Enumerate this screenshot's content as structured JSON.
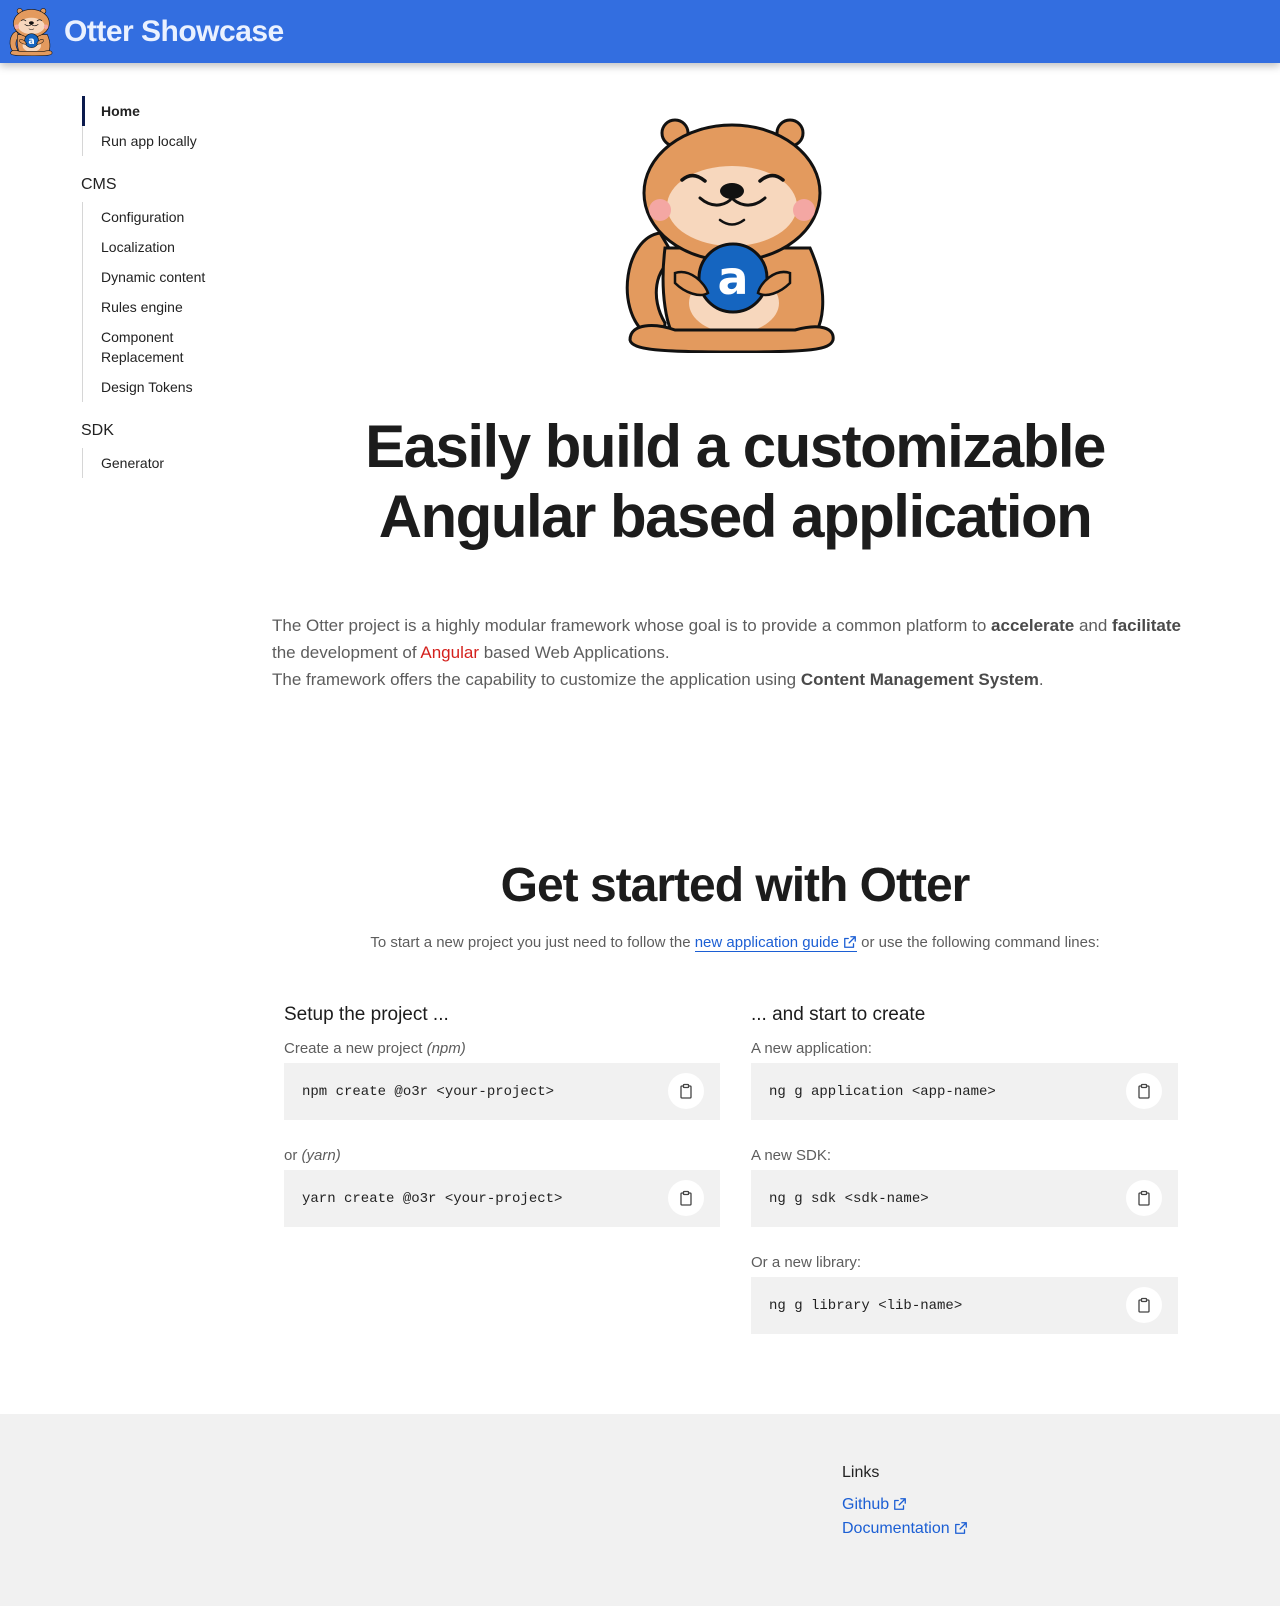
{
  "header": {
    "brand": "Otter Showcase",
    "logo_icon": "otter-logo-icon",
    "bar_color": "#336ee0"
  },
  "sidebar": {
    "top_items": [
      {
        "label": "Home",
        "active": true
      },
      {
        "label": "Run app locally"
      }
    ],
    "cms": {
      "heading": "CMS",
      "items": [
        "Configuration",
        "Localization",
        "Dynamic content",
        "Rules engine",
        "Component Replacement",
        "Design Tokens"
      ]
    },
    "sdk": {
      "heading": "SDK",
      "items": [
        "Generator"
      ]
    }
  },
  "hero": {
    "image_icon": "otter-mascot-icon",
    "mascot_letter": "a",
    "headline": "Easily build a customizable Angular based application"
  },
  "intro": {
    "p1_a": "The Otter project is a highly modular framework whose goal is to provide a common platform to ",
    "p1_b": "accelerate",
    "p1_c": " and ",
    "p1_d": "facilitate",
    "p1_e": " the development of ",
    "p1_f": "Angular",
    "p1_g": " based Web Applications.",
    "p2_a": "The framework offers the capability to customize the application using ",
    "p2_b": "Content Management System",
    "p2_c": "."
  },
  "get_started": {
    "title": "Get started with Otter",
    "sub_before": "To start a new project you just need to follow the ",
    "sub_link": "new application guide",
    "sub_after": " or use the following command lines:",
    "setup": {
      "title": "Setup the project ...",
      "npm_label": "Create a new project ",
      "npm_hint": "(npm)",
      "npm_cmd": "npm create @o3r <your-project>",
      "yarn_label": "or ",
      "yarn_hint": "(yarn)",
      "yarn_cmd": "yarn create @o3r <your-project>"
    },
    "create": {
      "title": "... and start to create",
      "app_label": "A new application:",
      "app_cmd": "ng g application <app-name>",
      "sdk_label": "A new SDK:",
      "sdk_cmd": "ng g sdk <sdk-name>",
      "lib_label": "Or a new library:",
      "lib_cmd": "ng g library <lib-name>"
    }
  },
  "footer": {
    "links_title": "Links",
    "github": "Github",
    "documentation": "Documentation"
  }
}
